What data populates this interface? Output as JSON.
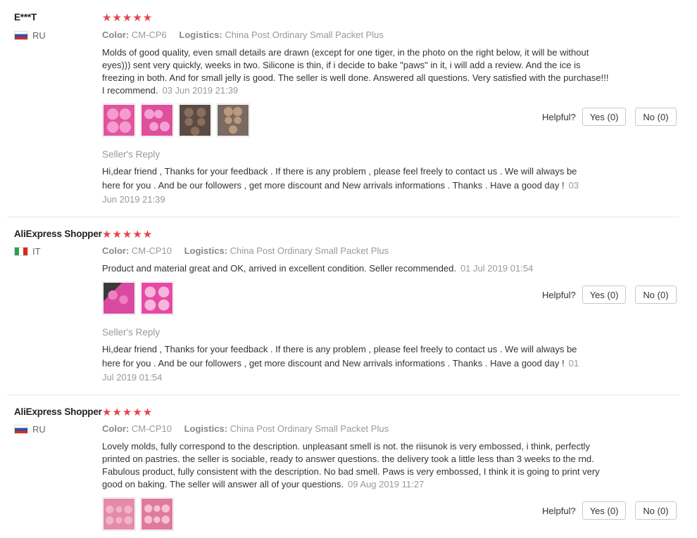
{
  "labels": {
    "color": "Color:",
    "logistics": "Logistics:",
    "helpful": "Helpful?",
    "seller_reply": "Seller's Reply",
    "stars": "★★★★★"
  },
  "reviews": [
    {
      "user": "E***T",
      "country": "RU",
      "flag": "ru",
      "rating": 5,
      "color": "CM-CP6",
      "logistics": "China Post Ordinary Small Packet Plus",
      "text": "Molds of good quality, even small details are drawn (except for one tiger, in the photo on the right below, it will be without eyes))) sent very quickly, weeks in two. Silicone is thin, if i decide to bake \"paws\" in it, i will add a review. And the ice is freezing in both. And for small jelly is good. The seller is well done. Answered all questions. Very satisfied with the purchase!!! I recommend.",
      "date": "03 Jun 2019 21:39",
      "yes": "Yes (0)",
      "no": "No (0)",
      "reply": "Hi,dear friend , Thanks for your feedback . If there is any problem , please feel freely to contact us . We will always be here for you . And be our followers , get more discount and New arrivals informations . Thanks . Have a good day !",
      "reply_date": "03 Jun 2019 21:39"
    },
    {
      "user": "AliExpress Shopper",
      "country": "IT",
      "flag": "it",
      "rating": 5,
      "color": "CM-CP10",
      "logistics": "China Post Ordinary Small Packet Plus",
      "text": "Product and material great and OK, arrived in excellent condition. Seller recommended.",
      "date": "01 Jul 2019 01:54",
      "yes": "Yes (0)",
      "no": "No (0)",
      "reply": "Hi,dear friend , Thanks for your feedback . If there is any problem , please feel freely to contact us . We will always be here for you . And be our followers , get more discount and New arrivals informations . Thanks . Have a good day !",
      "reply_date": "01 Jul 2019 01:54"
    },
    {
      "user": "AliExpress Shopper",
      "country": "RU",
      "flag": "ru",
      "rating": 5,
      "color": "CM-CP10",
      "logistics": "China Post Ordinary Small Packet Plus",
      "text": "Lovely molds, fully correspond to the description. unpleasant smell is not. the riisunok is very embossed, i think, perfectly printed on pastries. the seller is sociable, ready to answer questions. the delivery took a little less than 3 weeks to the rnd. Fabulous product, fully consistent with the description. No bad smell. Paws is very embossed, I think it is going to print very good on baking. The seller will answer all of your questions.",
      "date": "09 Aug 2019 11:27",
      "yes": "Yes (0)",
      "no": "No (0)"
    }
  ]
}
